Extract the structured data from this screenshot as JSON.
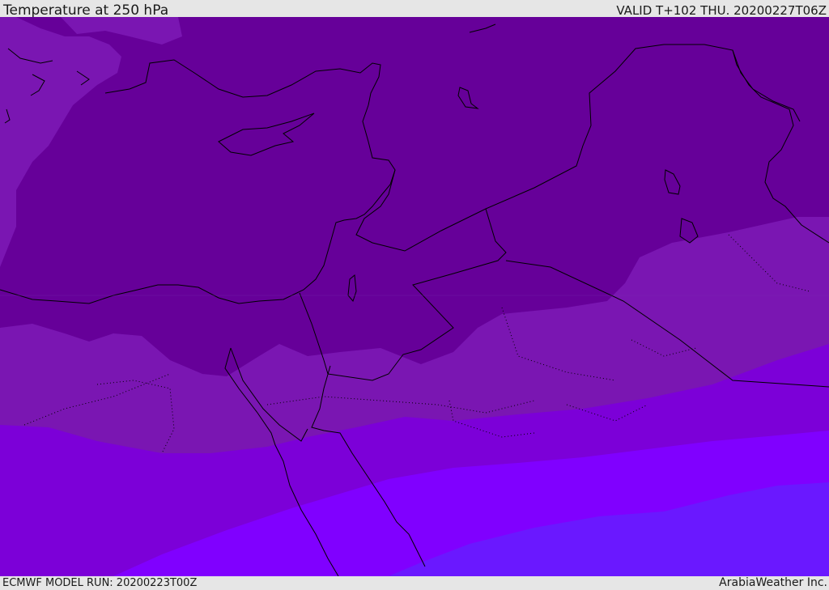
{
  "header": {
    "title": "Temperature at 250 hPa",
    "valid_time": "VALID T+102 THU. 20200227T06Z"
  },
  "footer": {
    "model_run": "ECMWF MODEL RUN: 20200223T00Z",
    "brand": "ArabiaWeather Inc."
  },
  "map": {
    "variable": "temperature",
    "pressure_level": "250 hPa",
    "band_colors": [
      "#7a16b2",
      "#660099",
      "#7810b4",
      "#7c00d8",
      "#8000ff",
      "#6a18ff"
    ],
    "border_color": "#000000"
  }
}
